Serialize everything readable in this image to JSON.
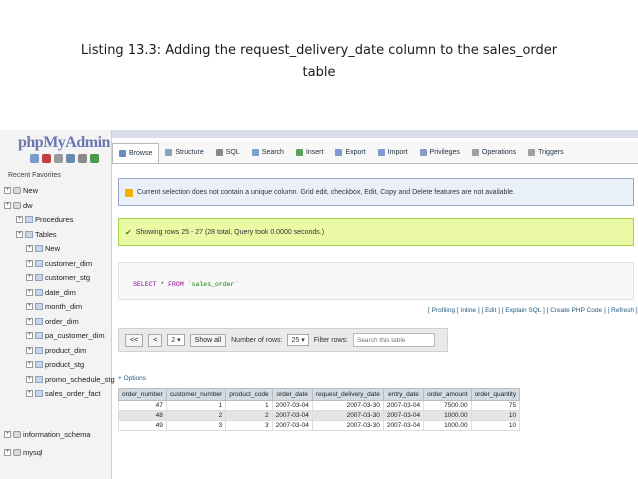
{
  "slide": {
    "title_line1": "Listing 13.3: Adding the request_delivery_date column to the sales_order",
    "title_line2": "table"
  },
  "sidebar": {
    "logo": "phpMyAdmin",
    "recent_label": "Recent",
    "favorites_label": "Favorites",
    "tree": [
      {
        "label": "New",
        "level": 0
      },
      {
        "label": "dw",
        "level": 0
      },
      {
        "label": "Procedures",
        "level": 1
      },
      {
        "label": "Tables",
        "level": 1
      },
      {
        "label": "New",
        "level": 2
      },
      {
        "label": "customer_dim",
        "level": 2
      },
      {
        "label": "customer_stg",
        "level": 2
      },
      {
        "label": "date_dim",
        "level": 2
      },
      {
        "label": "month_dim",
        "level": 2
      },
      {
        "label": "order_dim",
        "level": 2
      },
      {
        "label": "pa_customer_dim",
        "level": 2
      },
      {
        "label": "product_dim",
        "level": 2
      },
      {
        "label": "product_stg",
        "level": 2
      },
      {
        "label": "promo_schedule_stg",
        "level": 2
      },
      {
        "label": "sales_order_fact",
        "level": 2
      },
      {
        "label": "information_schema",
        "level": 0
      },
      {
        "label": "mysql",
        "level": 0
      }
    ]
  },
  "tabs": [
    {
      "label": "Browse",
      "color": "#6b8dbf"
    },
    {
      "label": "Structure",
      "color": "#8aa0c0"
    },
    {
      "label": "SQL",
      "color": "#8a8a8a"
    },
    {
      "label": "Search",
      "color": "#7aa0d0"
    },
    {
      "label": "Insert",
      "color": "#5aa05a"
    },
    {
      "label": "Export",
      "color": "#7a9ad0"
    },
    {
      "label": "Import",
      "color": "#7a9ad0"
    },
    {
      "label": "Privileges",
      "color": "#8a9ac0"
    },
    {
      "label": "Operations",
      "color": "#a0a0a0"
    },
    {
      "label": "Triggers",
      "color": "#a0a0a0"
    }
  ],
  "notice_text": "Current selection does not contain a unique column. Grid edit, checkbox, Edit, Copy and Delete features are not available.",
  "success_text": "Showing rows 25 - 27 (28 total, Query took 0.0000 seconds.)",
  "sql": {
    "keyword1": "SELECT",
    "star": "*",
    "keyword2": "FROM",
    "table": "`sales_order`"
  },
  "sql_links": "[ Profiling [ Inline ] [ Edit ] [ Explain SQL ] [ Create PHP Code ] [ Refresh ]",
  "nav": {
    "prev_label": "<<",
    "prev_one_label": "<",
    "page_value": "2",
    "show_all_label": "Show all",
    "rows_label": "Number of rows:",
    "rows_value": "25",
    "filter_label": "Filter rows:",
    "filter_placeholder": "Search this table"
  },
  "options_label": "+ Options",
  "table": {
    "columns": [
      "order_number",
      "customer_number",
      "product_code",
      "order_date",
      "request_delivery_date",
      "entry_date",
      "order_amount",
      "order_quantity"
    ],
    "rows": [
      [
        "47",
        "1",
        "1",
        "2007-03-04",
        "2007-03-30",
        "2007-03-04",
        "7500.00",
        "75"
      ],
      [
        "48",
        "2",
        "2",
        "2007-03-04",
        "2007-03-30",
        "2007-03-04",
        "1000.00",
        "10"
      ],
      [
        "49",
        "3",
        "3",
        "2007-03-04",
        "2007-03-30",
        "2007-03-04",
        "1000.00",
        "10"
      ]
    ]
  }
}
